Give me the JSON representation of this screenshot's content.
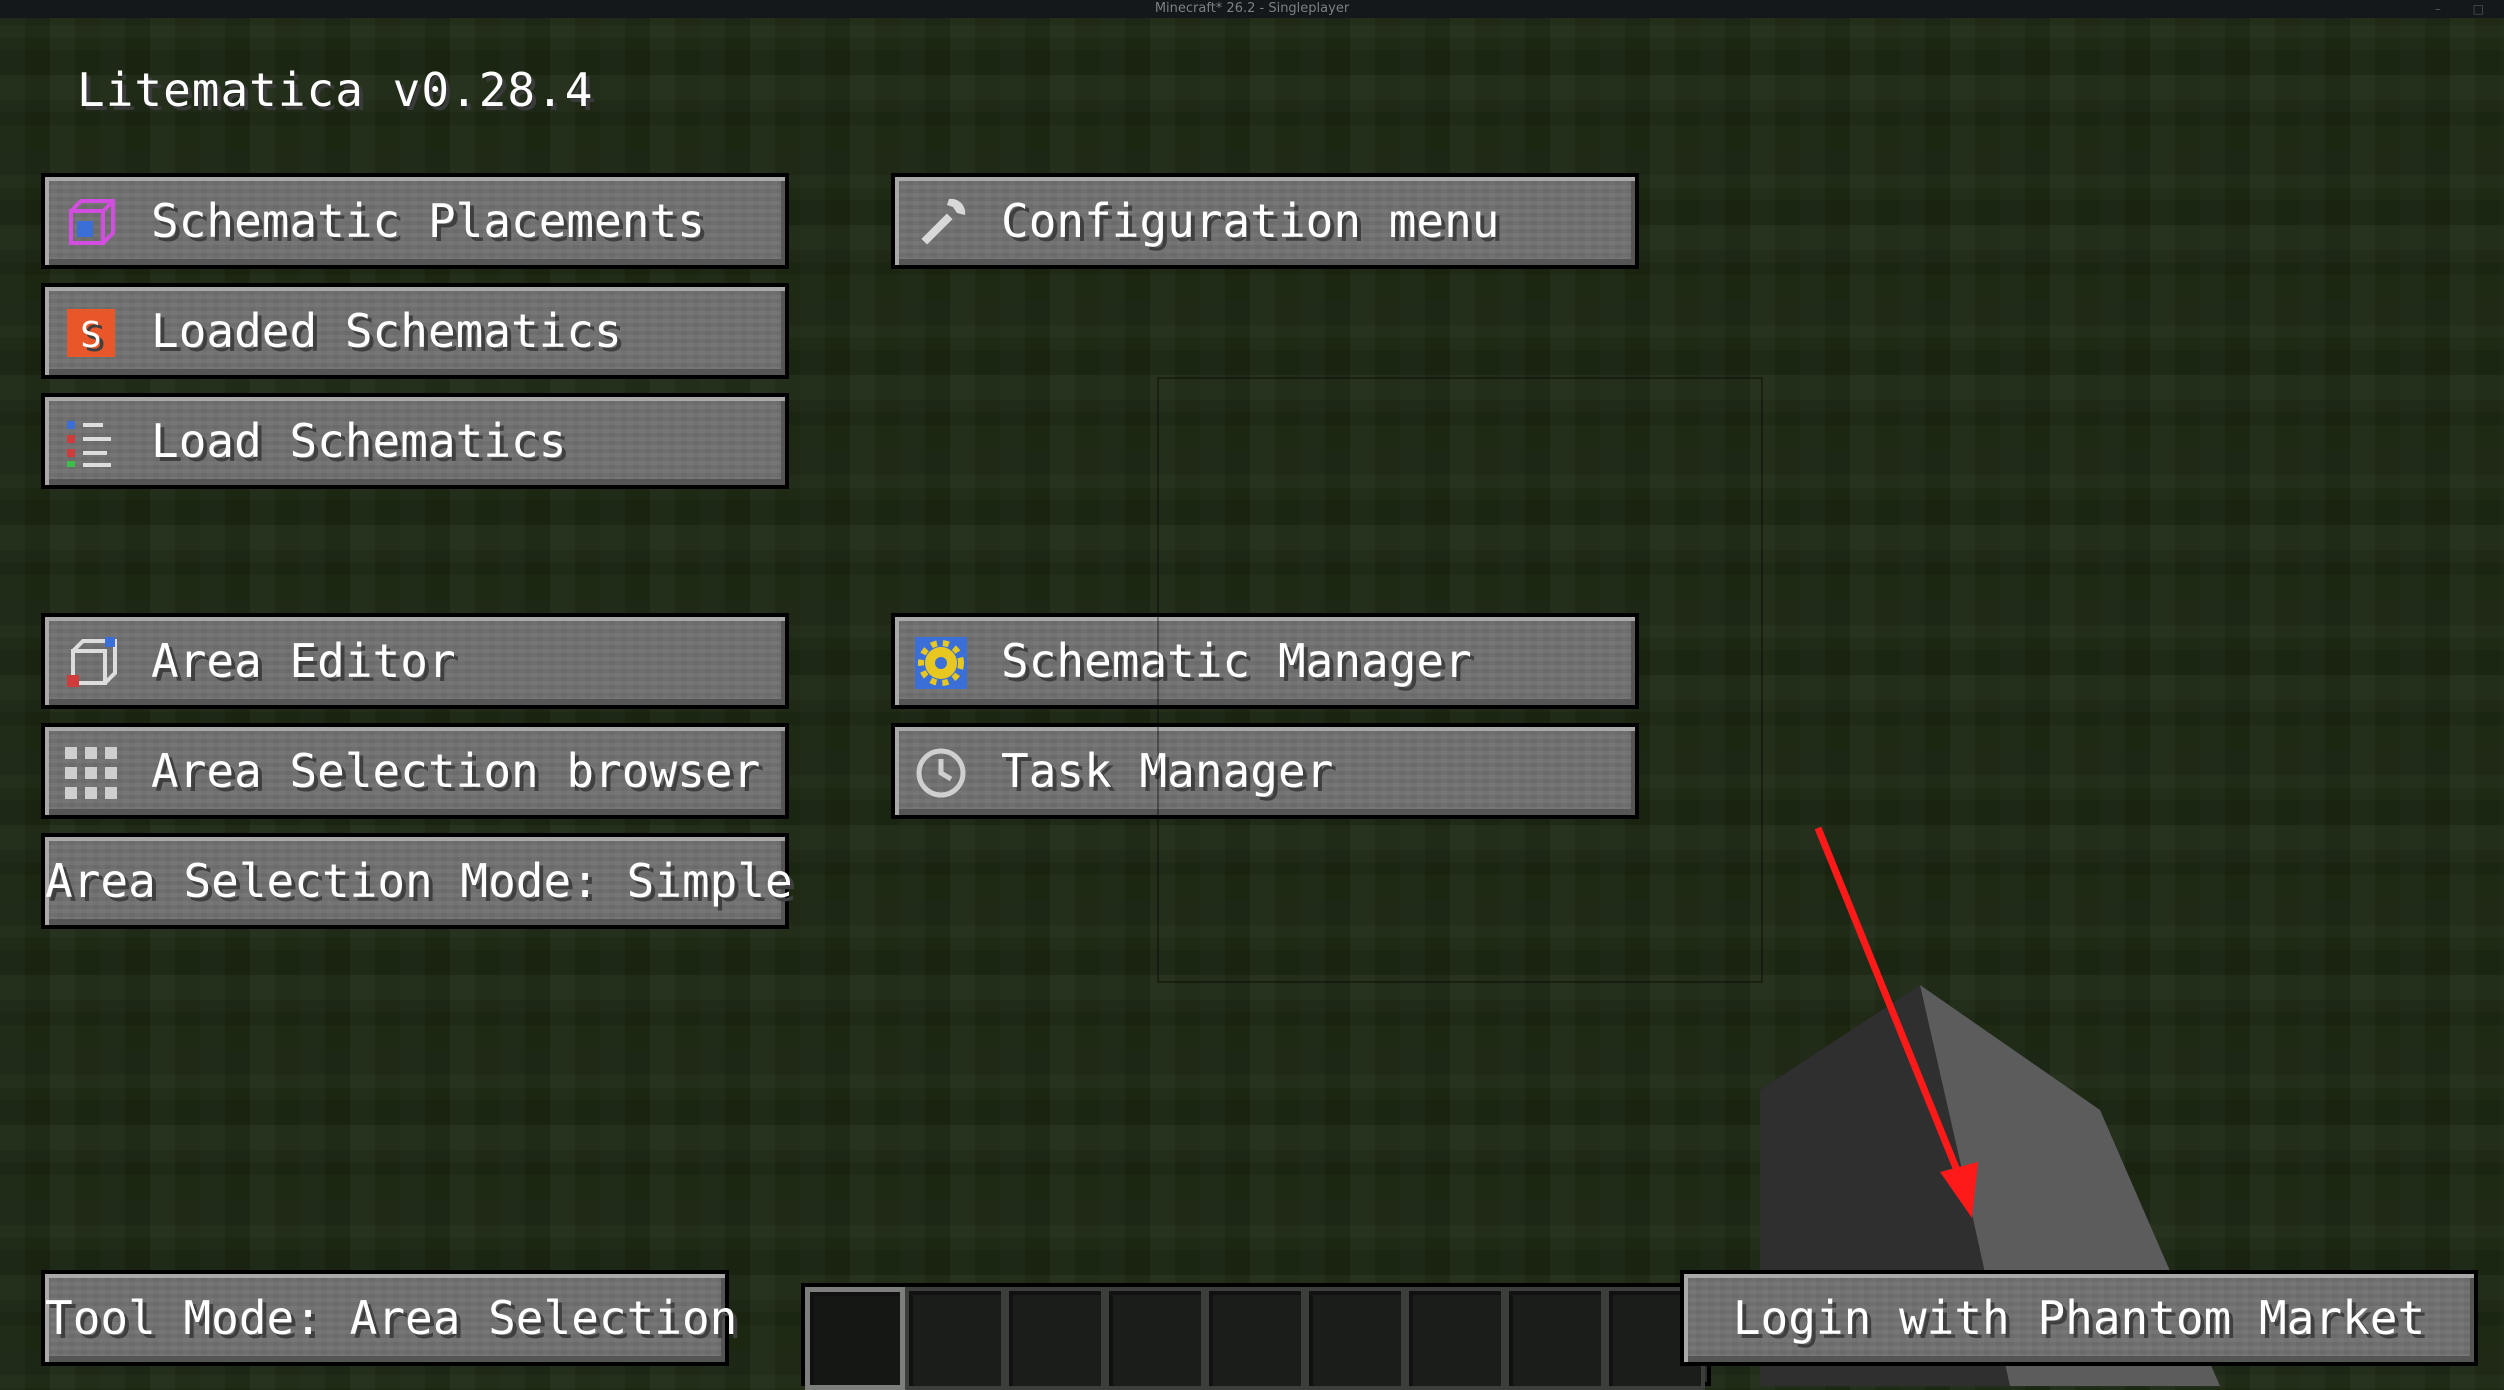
{
  "window": {
    "title": "Minecraft* 26.2 - Singleplayer"
  },
  "app_title": "Litematica v0.28.4",
  "buttons": {
    "schematic_placements": "Schematic Placements",
    "configuration_menu": "Configuration menu",
    "loaded_schematics": "Loaded Schematics",
    "load_schematics": "Load Schematics",
    "area_editor": "Area Editor",
    "schematic_manager": "Schematic Manager",
    "area_selection_browser": "Area Selection browser",
    "task_manager": "Task Manager",
    "area_selection_mode": "Area Selection Mode: Simple",
    "tool_mode": "Tool Mode: Area Selection",
    "login": "Login with Phantom Market"
  },
  "icons": {
    "schematic_placements": "cube-icon",
    "configuration_menu": "wrench-icon",
    "loaded_schematics": "schematic-s-icon",
    "load_schematics": "list-icon",
    "area_editor": "area-box-icon",
    "schematic_manager": "gear-icon",
    "area_selection_browser": "grid-icon",
    "task_manager": "clock-icon"
  },
  "colors": {
    "background": "#1e2a14",
    "button": "#6f6f6f",
    "text": "#ffffff",
    "annotation_arrow": "#ff1a1a"
  },
  "hotbar": {
    "slot_count": 9,
    "selected_slot": 1
  }
}
